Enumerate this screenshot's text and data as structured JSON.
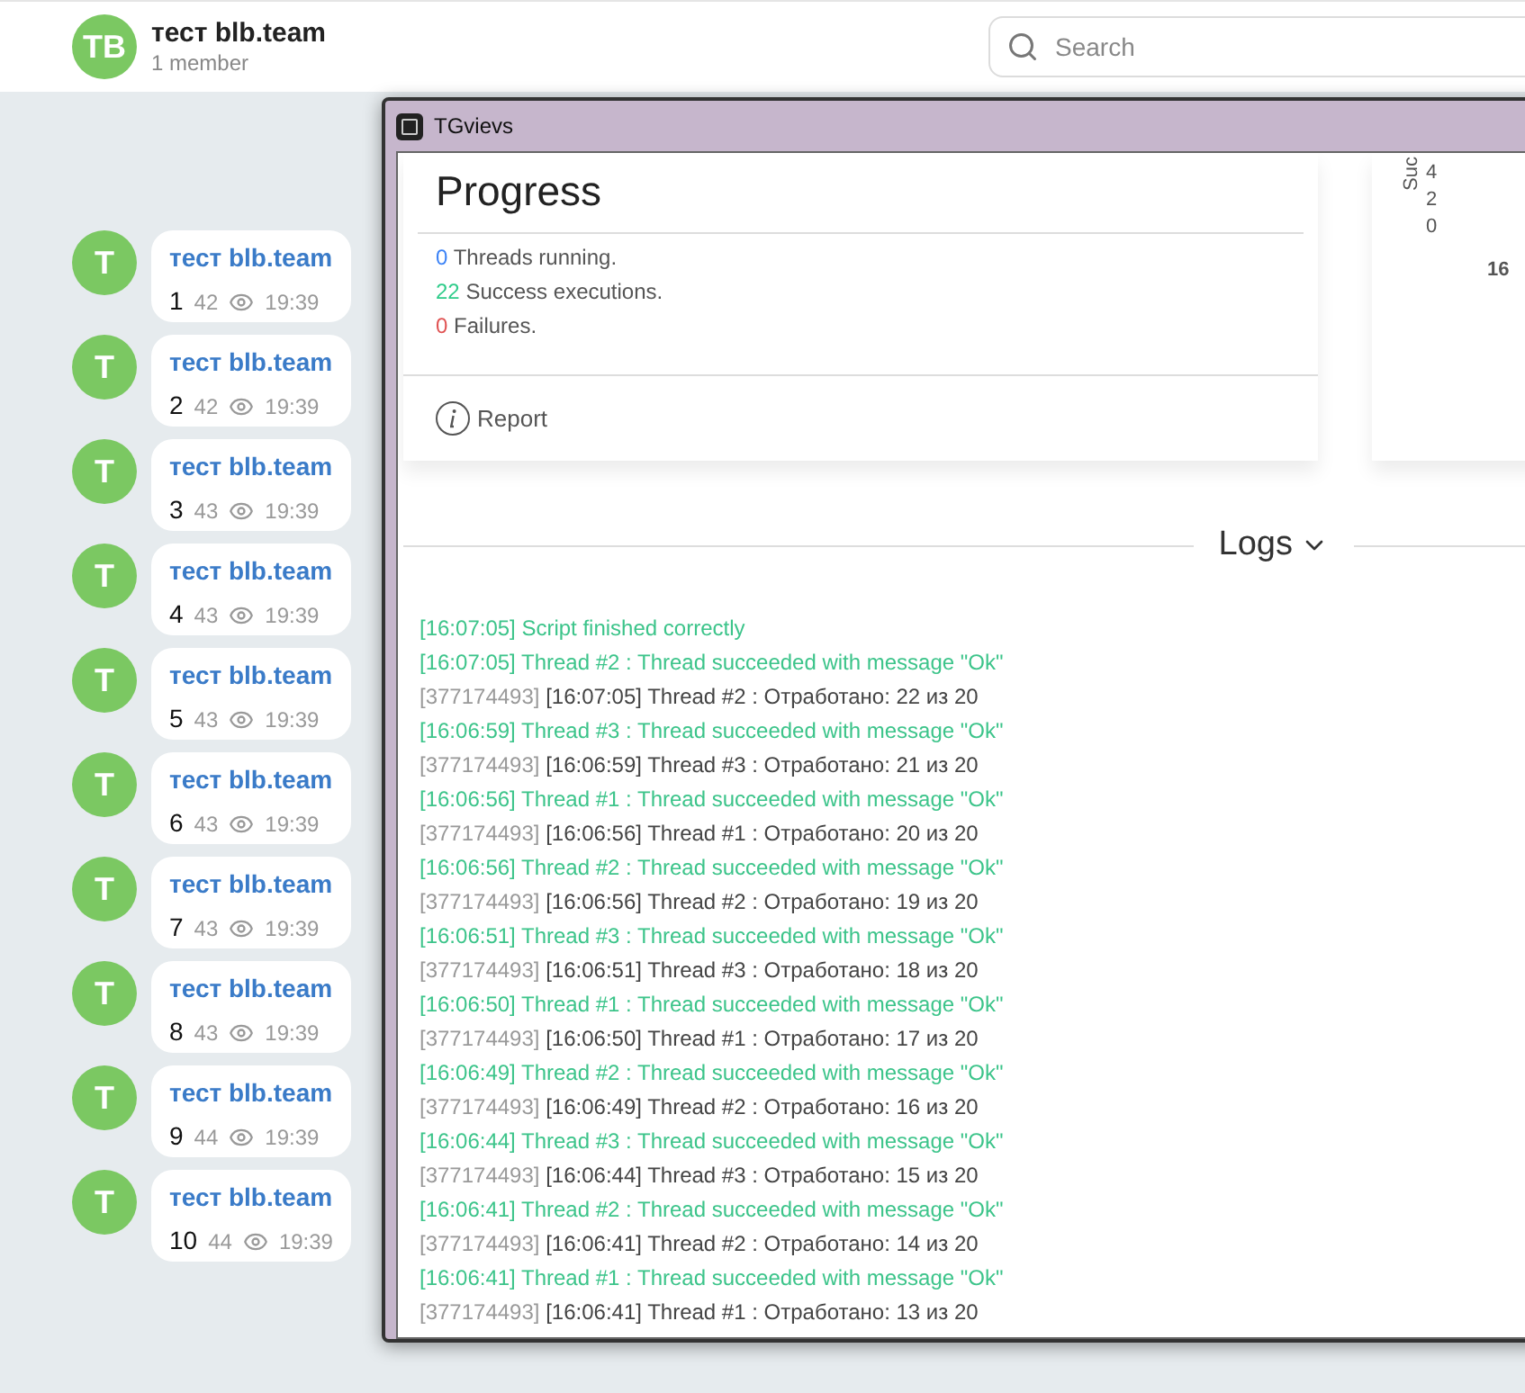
{
  "chat_header": {
    "avatar": "TB",
    "title": "тест blb.team",
    "subtitle": "1 member"
  },
  "search": {
    "placeholder": "Search"
  },
  "messages": [
    {
      "avatar": "T",
      "author": "тест blb.team",
      "text": "1",
      "views": "42",
      "time": "19:39"
    },
    {
      "avatar": "T",
      "author": "тест blb.team",
      "text": "2",
      "views": "42",
      "time": "19:39"
    },
    {
      "avatar": "T",
      "author": "тест blb.team",
      "text": "3",
      "views": "43",
      "time": "19:39"
    },
    {
      "avatar": "T",
      "author": "тест blb.team",
      "text": "4",
      "views": "43",
      "time": "19:39"
    },
    {
      "avatar": "T",
      "author": "тест blb.team",
      "text": "5",
      "views": "43",
      "time": "19:39"
    },
    {
      "avatar": "T",
      "author": "тест blb.team",
      "text": "6",
      "views": "43",
      "time": "19:39"
    },
    {
      "avatar": "T",
      "author": "тест blb.team",
      "text": "7",
      "views": "43",
      "time": "19:39"
    },
    {
      "avatar": "T",
      "author": "тест blb.team",
      "text": "8",
      "views": "43",
      "time": "19:39"
    },
    {
      "avatar": "T",
      "author": "тест blb.team",
      "text": "9",
      "views": "44",
      "time": "19:39"
    },
    {
      "avatar": "T",
      "author": "тест blb.team",
      "text": "10",
      "views": "44",
      "time": "19:39"
    }
  ],
  "window": {
    "title": "TGvievs"
  },
  "progress": {
    "title": "Progress",
    "stats": [
      {
        "kind": "running",
        "count": "0",
        "label": "Threads running."
      },
      {
        "kind": "success",
        "count": "22",
        "label": "Success executions."
      },
      {
        "kind": "failure",
        "count": "0",
        "label": "Failures."
      }
    ],
    "report_link": "Report"
  },
  "chart_fragment": {
    "axis_label": "Suc",
    "ticks": [
      "4",
      "2",
      "0"
    ],
    "x_tick": "16"
  },
  "logs": {
    "title": "Logs",
    "lines": [
      {
        "kind": "success",
        "text": "[16:07:05] Script finished correctly"
      },
      {
        "kind": "success",
        "text": "[16:07:05] Thread #2 : Thread succeeded with message \"Ok\""
      },
      {
        "kind": "progress",
        "id": "[377174493]",
        "text": "[16:07:05] Thread #2 : Отработано: 22 из 20"
      },
      {
        "kind": "success",
        "text": "[16:06:59] Thread #3 : Thread succeeded with message \"Ok\""
      },
      {
        "kind": "progress",
        "id": "[377174493]",
        "text": "[16:06:59] Thread #3 : Отработано: 21 из 20"
      },
      {
        "kind": "success",
        "text": "[16:06:56] Thread #1 : Thread succeeded with message \"Ok\""
      },
      {
        "kind": "progress",
        "id": "[377174493]",
        "text": "[16:06:56] Thread #1 : Отработано: 20 из 20"
      },
      {
        "kind": "success",
        "text": "[16:06:56] Thread #2 : Thread succeeded with message \"Ok\""
      },
      {
        "kind": "progress",
        "id": "[377174493]",
        "text": "[16:06:56] Thread #2 : Отработано: 19 из 20"
      },
      {
        "kind": "success",
        "text": "[16:06:51] Thread #3 : Thread succeeded with message \"Ok\""
      },
      {
        "kind": "progress",
        "id": "[377174493]",
        "text": "[16:06:51] Thread #3 : Отработано: 18 из 20"
      },
      {
        "kind": "success",
        "text": "[16:06:50] Thread #1 : Thread succeeded with message \"Ok\""
      },
      {
        "kind": "progress",
        "id": "[377174493]",
        "text": "[16:06:50] Thread #1 : Отработано: 17 из 20"
      },
      {
        "kind": "success",
        "text": "[16:06:49] Thread #2 : Thread succeeded with message \"Ok\""
      },
      {
        "kind": "progress",
        "id": "[377174493]",
        "text": "[16:06:49] Thread #2 : Отработано: 16 из 20"
      },
      {
        "kind": "success",
        "text": "[16:06:44] Thread #3 : Thread succeeded with message \"Ok\""
      },
      {
        "kind": "progress",
        "id": "[377174493]",
        "text": "[16:06:44] Thread #3 : Отработано: 15 из 20"
      },
      {
        "kind": "success",
        "text": "[16:06:41] Thread #2 : Thread succeeded with message \"Ok\""
      },
      {
        "kind": "progress",
        "id": "[377174493]",
        "text": "[16:06:41] Thread #2 : Отработано: 14 из 20"
      },
      {
        "kind": "success",
        "text": "[16:06:41] Thread #1 : Thread succeeded with message \"Ok\""
      },
      {
        "kind": "progress",
        "id": "[377174493]",
        "text": "[16:06:41] Thread #1 : Отработано: 13 из 20"
      }
    ]
  }
}
